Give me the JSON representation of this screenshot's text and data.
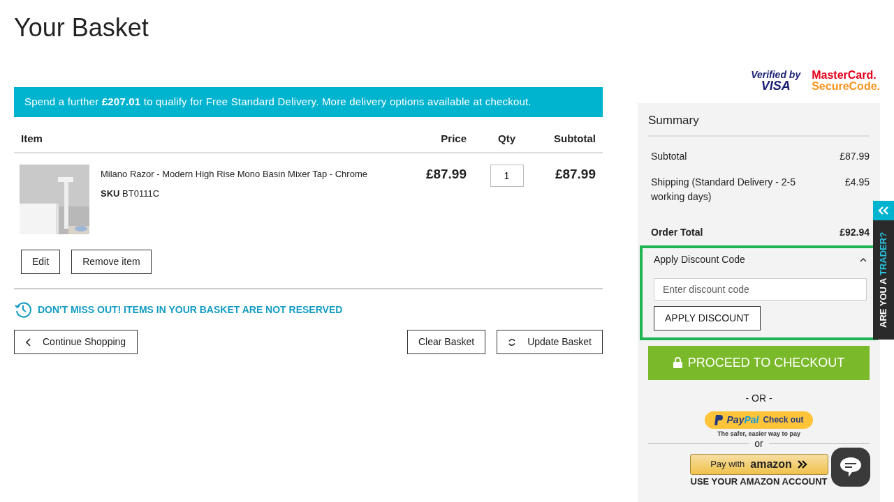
{
  "page_title": "Your Basket",
  "security_logos": {
    "visa_top": "Verified by",
    "visa_bottom": "VISA",
    "mc_top": "MasterCard.",
    "mc_bottom": "SecureCode."
  },
  "banner": "Spend a further **£207.01** to qualify for Free Standard Delivery. More delivery options available at checkout.",
  "table": {
    "columns": [
      "Item",
      "Price",
      "Qty",
      "Subtotal"
    ],
    "rows": [
      {
        "image": {
          "kind": "picture"
        },
        "name": "Milano Razor - Modern High Rise Mono Basin Mixer Tap - Chrome",
        "sku": "**SKU** BT0111C",
        "price": "£87.99",
        "qty": "1",
        "subtotal": "£87.99",
        "actions": [
          "Edit",
          "Remove item"
        ]
      }
    ]
  },
  "notice": "DON'T MISS OUT! ITEMS IN YOUR BASKET ARE NOT RESERVED",
  "buttons": {
    "continue": "Continue Shopping",
    "clear": "Clear Basket",
    "update": "Update Basket"
  },
  "summary": {
    "title": "Summary",
    "rows": [
      {
        "label": "Subtotal",
        "value": "£87.99",
        "kind": "normal"
      },
      {
        "label": "Shipping (Standard Delivery - 2-5 working days)",
        "value": "£4.95",
        "kind": "normal"
      },
      {
        "label": "Order Total",
        "value": "£92.94",
        "kind": "total"
      }
    ],
    "discount": {
      "title": "Apply Discount Code",
      "expanded": true,
      "placeholder": "Enter discount code",
      "button": "APPLY DISCOUNT"
    },
    "checkout": "PROCEED TO CHECKOUT",
    "or": "- OR -",
    "paypal": {
      "brand_1": "Pay",
      "brand_2": "Pal",
      "action": "Check out",
      "tagline": "The safer, easier way to pay"
    },
    "or_2": "or",
    "amazon": {
      "prefix": "Pay with",
      "brand": "amazon",
      "caption": "USE YOUR AMAZON ACCOUNT"
    }
  },
  "trader_tab": {
    "text_1": "ARE YOU A",
    "text_2": "TRADER?"
  }
}
